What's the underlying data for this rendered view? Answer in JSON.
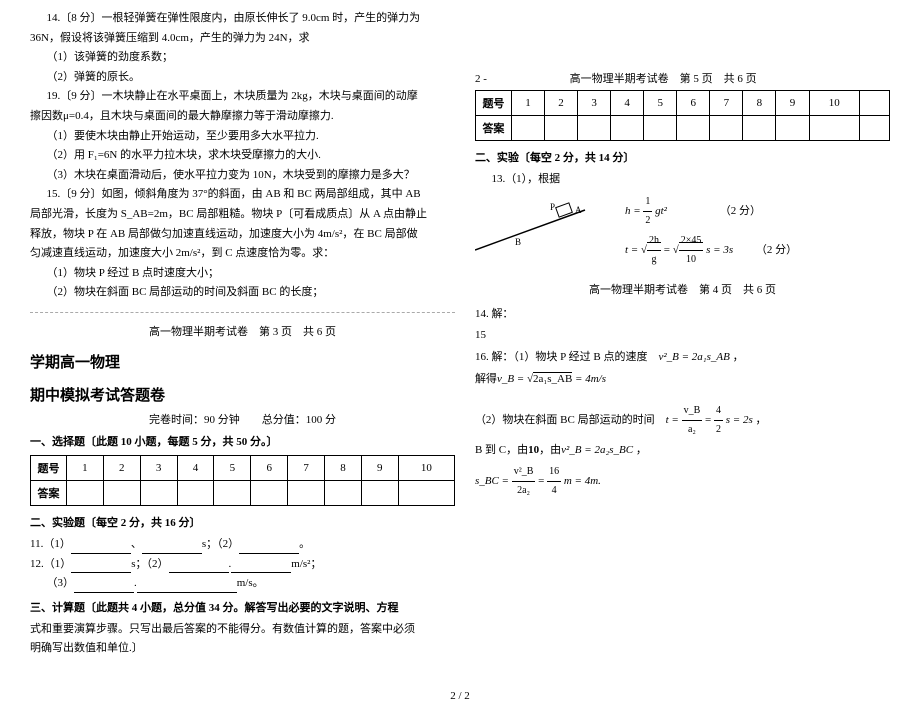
{
  "problems": {
    "p14_header": "14.〔8 分〕一根轻弹簧在弹性限度内，由原长伸长了 9.0cm 时，产生的弹力为",
    "p14_line2": "36N，假设将该弹簧压缩到 4.0cm，产生的弹力为 24N，求",
    "p14_q1": "（1）该弹簧的劲度系数；",
    "p14_q2": "（2）弹簧的原长。",
    "p19_header": "19.〔9 分〕一木块静止在水平桌面上，木块质量为 2kg，木块与桌面间的动摩",
    "p19_line2": "擦因数μ=0.4，且木块与桌面间的最大静摩擦力等于滑动摩擦力.",
    "p19_q1": "（1）要使木块由静止开始运动，至少要用多大水平拉力.",
    "p19_q2": "（2）用 F₁=6N 的水平力拉木块，求木块受摩擦力的大小.",
    "p19_q3": "（3）木块在桌面滑动后，使水平拉力变为 10N，木块受到的摩擦力是多大？",
    "p15_header": "15.〔9 分〕如图，倾斜角度为 37°的斜面，由 AB 和 BC 两局部组成，其中 AB",
    "p15_line2": "局部光滑，长度为 S_AB=2m，BC 局部粗糙。物块 P〔可看成质点〕从 A 点由静止",
    "p15_line3": "释放，物块 P 在 AB 局部做匀加速直线运动，加速度大小为 4m/s²，在 BC 局部做",
    "p15_line4": "匀减速直线运动，加速度大小 2m/s²，到 C 点速度恰为零。求：",
    "p15_q1": "（1）物块 P 经过 B 点时速度大小；",
    "p15_q2": "（2）物块在斜面 BC 局部运动的时间及斜面 BC 的长度；"
  },
  "page3_header": "高一物理半期考试卷　第 3 页　共 6 页",
  "page5_header": "高一物理半期考试卷　第 5 页　共 6 页",
  "page4_header": "高一物理半期考试卷　第 4 页　共 6 页",
  "answersheet": {
    "title1": "学期高一物理",
    "title2": "期中模拟考试答题卷",
    "time_info": "完卷时间：90 分钟",
    "score_info": "总分值：100 分",
    "section1": "一、选择题〔此题 10 小题，每题 5 分，共 50 分。〕",
    "row_label": "题号",
    "ans_label": "答案",
    "section2": "二、实验题〔每空 2 分，共 16 分〕",
    "q11": "11.（1）",
    "q11_sep": "、",
    "q11_unit_s": "s；（2）",
    "q11_end": "。",
    "q12": "12.（1）",
    "q12_unit_s": "s；（2）",
    "q12_sep": ".",
    "q12_unit_ms2": "m/s²；",
    "q12_3": "（3）",
    "q12_unit_ms": "m/s。",
    "section3": "三、计算题〔此题共 4 小题，总分值 34 分。解答写出必要的文字说明、方程",
    "section3_line2": "式和重要演算步骤。只写出最后答案的不能得分。有数值计算的题，答案中必须",
    "section3_line3": "明确写出数值和单位.〕"
  },
  "right_top": {
    "minus2": "2 -",
    "section2_r": "二、实验〔每空 2 分，共 14 分〕",
    "q13": "13.（1），根据",
    "formula1_label": "（2 分）",
    "formula2_label": "（2 分）"
  },
  "solutions": {
    "s14": "14. 解：",
    "s15": "15",
    "s16": "16. 解：（1）物块 P 经过 B 点的速度",
    "s16_formula1": "v²_B = 2a₁s_AB",
    "s16_line2_pre": "解得",
    "s16_vb": "v_B = √(2a₁s_AB) = 4m/s",
    "s16_2": "（2）物块在斜面 BC 局部运动的时间",
    "s16_t_formula": "t = v_B/a₂ = 4/2 s = 2s",
    "s16_bc_pre": "B 到 C，由",
    "s16_bc_note": "10",
    "s16_vb2": "v²_B = 2a₂s_BC",
    "s16_sbc": "s_BC = v²_B/(2a₂) = 16/4 m = 4m."
  },
  "cols": [
    "1",
    "2",
    "3",
    "4",
    "5",
    "6",
    "7",
    "8",
    "9",
    "10"
  ],
  "page_num": "2 / 2"
}
